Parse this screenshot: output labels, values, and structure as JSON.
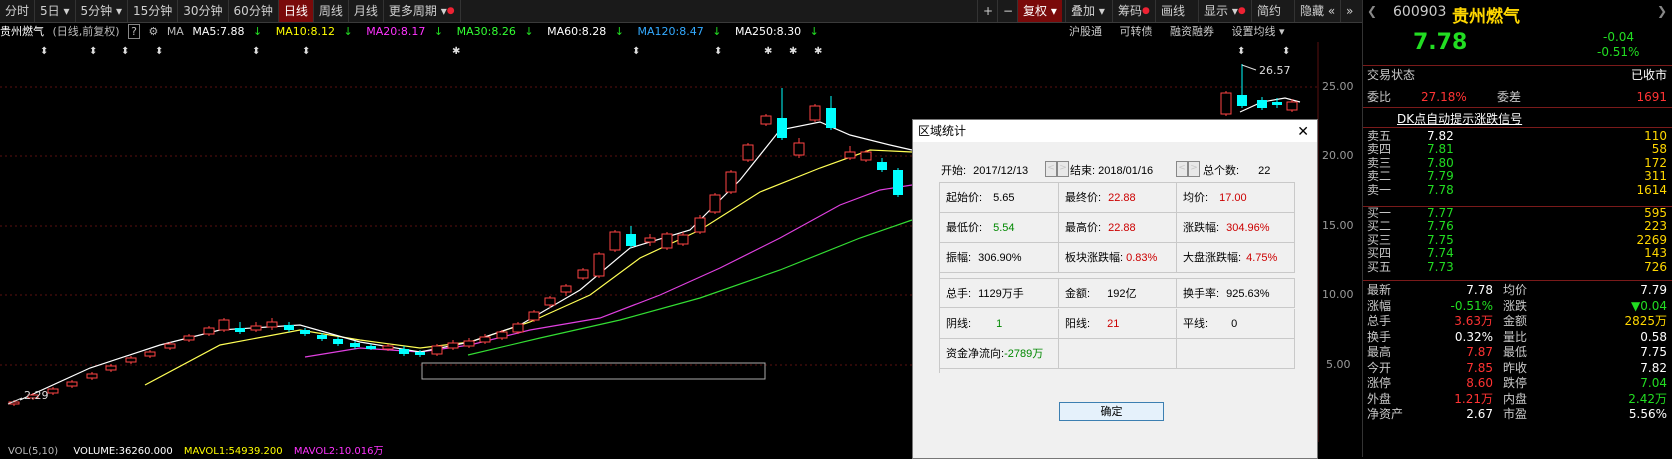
{
  "toolbar": {
    "periods": [
      "分时",
      "5日",
      "5分钟",
      "15分钟",
      "30分钟",
      "60分钟",
      "日线",
      "周线",
      "月线",
      "更多周期"
    ],
    "active": "日线",
    "right_items": [
      "+",
      "−",
      "复权",
      "叠加",
      "筹码",
      "画线",
      "显示",
      "简约",
      "隐藏"
    ]
  },
  "ma_bar": {
    "stock": "贵州燃气",
    "mode": "(日线,前复权)",
    "ma_label": "MA",
    "ma5": "MA5:7.88",
    "ma10": "MA10:8.12",
    "ma20": "MA20:8.17",
    "ma30": "MA30:8.26",
    "ma60": "MA60:8.28",
    "ma120": "MA120:8.47",
    "ma250": "MA250:8.30",
    "links": [
      "沪股通",
      "可转债",
      "融资融券",
      "设置均线"
    ]
  },
  "colors": {
    "ma5": "#ffffff",
    "ma10": "#ffff00",
    "ma20": "#ff33ff",
    "ma30": "#33ff33",
    "up": "#ff4444",
    "down": "#00ffff",
    "accent": "#7a0a0a"
  },
  "chart": {
    "y_ticks": [
      "25.00",
      "20.00",
      "15.00",
      "10.00",
      "5.00"
    ],
    "high_label": "26.57",
    "low_label": "2.29"
  },
  "volume_bar": {
    "text": "VOL(5,10)",
    "volume": "VOLUME:36260.000",
    "mavol1": "MAVOL1:54939.200",
    "mavol2": "MAVOL2:10.016万"
  },
  "dialog": {
    "title": "区域统计",
    "start_label": "开始:",
    "start": "2017/12/13",
    "end_label": "结束:",
    "end": "2018/01/16",
    "count_label": "总个数:",
    "count": "22",
    "cells": {
      "open_label": "起始价:",
      "open": "5.65",
      "close_label": "最终价:",
      "close": "22.88",
      "avg_label": "均价:",
      "avg": "17.00",
      "low_label": "最低价:",
      "low": "5.54",
      "high_label": "最高价:",
      "high": "22.88",
      "chg_label": "涨跌幅:",
      "chg": "304.96%",
      "amp_label": "振幅:",
      "amp": "306.90%",
      "sector_label": "板块涨跌幅:",
      "sector": "0.83%",
      "market_label": "大盘涨跌幅:",
      "market": "4.75%",
      "vol_label": "总手:",
      "vol": "1129万手",
      "amt_label": "金额:",
      "amt": "192亿",
      "turn_label": "换手率:",
      "turn": "925.63%",
      "neg_label": "阴线:",
      "neg": "1",
      "pos_label": "阳线:",
      "pos": "21",
      "flat_label": "平线:",
      "flat": "0",
      "flow_label": "资金净流向:",
      "flow": "-2789万"
    },
    "ok": "确定"
  },
  "quote": {
    "code": "600903",
    "name": "贵州燃气",
    "price": "7.78",
    "change": "-0.04",
    "pct": "-0.51%",
    "status_label": "交易状态",
    "status": "已收市",
    "wb_label": "委比",
    "wb": "27.18%",
    "wc_label": "委差",
    "wc": "1691",
    "signal": "DK点自动提示涨跌信号",
    "asks": [
      {
        "l": "卖五",
        "p": "7.82",
        "v": "110"
      },
      {
        "l": "卖四",
        "p": "7.81",
        "v": "58"
      },
      {
        "l": "卖三",
        "p": "7.80",
        "v": "172"
      },
      {
        "l": "卖二",
        "p": "7.79",
        "v": "311"
      },
      {
        "l": "卖一",
        "p": "7.78",
        "v": "1614"
      }
    ],
    "bids": [
      {
        "l": "买一",
        "p": "7.77",
        "v": "595"
      },
      {
        "l": "买二",
        "p": "7.76",
        "v": "223"
      },
      {
        "l": "买三",
        "p": "7.75",
        "v": "2269"
      },
      {
        "l": "买四",
        "p": "7.74",
        "v": "143"
      },
      {
        "l": "买五",
        "p": "7.73",
        "v": "726"
      }
    ],
    "stats": [
      {
        "a": "最新",
        "av": "7.78",
        "b": "均价",
        "bv": "7.79"
      },
      {
        "a": "涨幅",
        "av": "-0.51%",
        "b": "涨跌",
        "bv": "▼0.04"
      },
      {
        "a": "总手",
        "av": "3.63万",
        "b": "金额",
        "bv": "2825万"
      },
      {
        "a": "换手",
        "av": "0.32%",
        "b": "量比",
        "bv": "0.58"
      },
      {
        "a": "最高",
        "av": "7.87",
        "b": "最低",
        "bv": "7.75"
      },
      {
        "a": "今开",
        "av": "7.85",
        "b": "昨收",
        "bv": "7.82"
      },
      {
        "a": "涨停",
        "av": "8.60",
        "b": "跌停",
        "bv": "7.04"
      },
      {
        "a": "外盘",
        "av": "1.21万",
        "b": "内盘",
        "bv": "2.42万"
      },
      {
        "a": "净资产",
        "av": "2.67",
        "b": "市盈",
        "bv": "5.56%"
      }
    ]
  }
}
